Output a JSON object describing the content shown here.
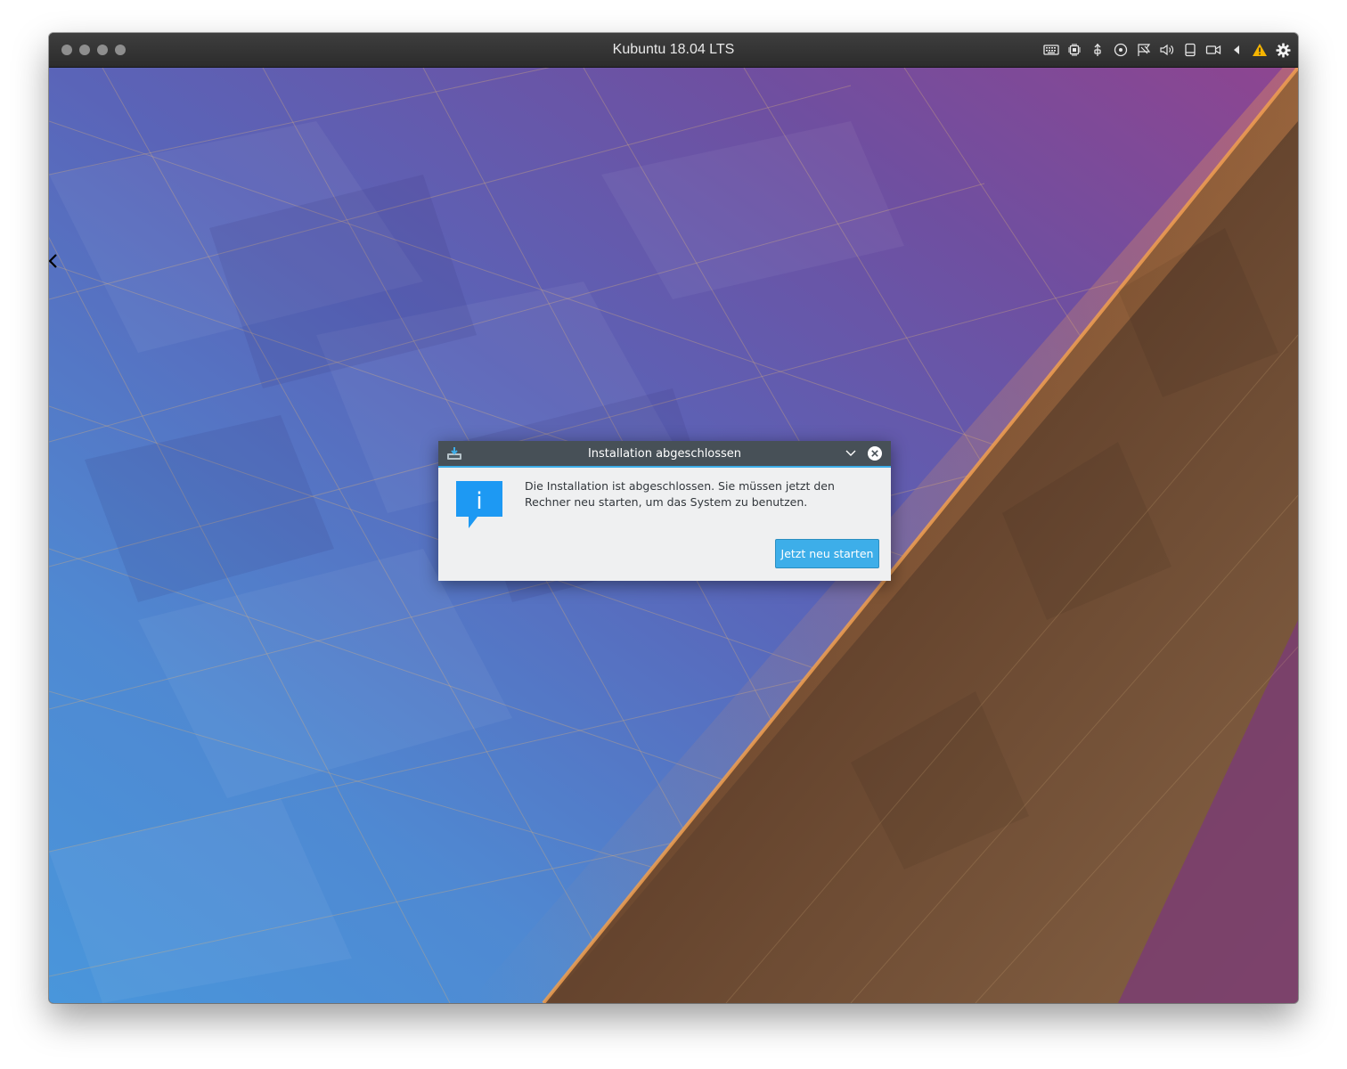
{
  "vm_window": {
    "title": "Kubuntu 18.04 LTS",
    "toolbar_icons": [
      "keyboard-icon",
      "cpu-icon",
      "usb-icon",
      "cd-icon",
      "network-icon",
      "sound-icon",
      "device-icon",
      "camera-icon",
      "arrow-left-icon",
      "warning-icon",
      "gear-icon"
    ]
  },
  "dialog": {
    "title": "Installation abgeschlossen",
    "message": "Die Installation ist abgeschlossen. Sie müssen jetzt den Rechner neu starten, um das System zu benutzen.",
    "button_label": "Jetzt neu starten",
    "info_icon_glyph": "i"
  },
  "colors": {
    "accent": "#3daee9",
    "dialog_titlebar": "#475057",
    "dialog_background": "#eff0f1",
    "warning": "#f5b400"
  }
}
